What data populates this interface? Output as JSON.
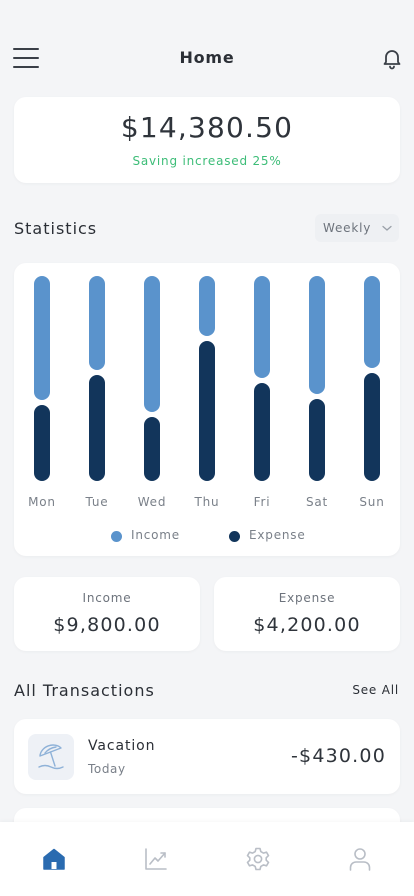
{
  "header": {
    "title": "Home",
    "menu_icon": "hamburger-menu-icon",
    "notification_icon": "bell-icon"
  },
  "balance": {
    "amount": "$14,380.50",
    "saving_text": "Saving increased 25%",
    "saving_color": "#3dbd78"
  },
  "statistics": {
    "title": "Statistics",
    "period": "Weekly",
    "legend": {
      "income": "Income",
      "expense": "Expense"
    }
  },
  "chart_data": {
    "type": "bar",
    "stacked": true,
    "categories": [
      "Mon",
      "Tue",
      "Wed",
      "Thu",
      "Fri",
      "Sat",
      "Sun"
    ],
    "series": [
      {
        "name": "Income",
        "color": "#5a93cc",
        "values": [
          62,
          47,
          68,
          30,
          51,
          59,
          46
        ]
      },
      {
        "name": "Expense",
        "color": "#12355b",
        "values": [
          38,
          53,
          32,
          70,
          49,
          41,
          54
        ]
      }
    ],
    "ylim": [
      0,
      100
    ],
    "grid": false,
    "legend_position": "bottom-center"
  },
  "summary": {
    "income_label": "Income",
    "income_value": "$9,800.00",
    "expense_label": "Expense",
    "expense_value": "$4,200.00"
  },
  "transactions": {
    "title": "All Transactions",
    "see_all": "See All",
    "items": [
      {
        "name": "Vacation",
        "date": "Today",
        "amount": "-$430.00",
        "icon": "beach-umbrella-icon"
      }
    ]
  },
  "nav": {
    "items": [
      {
        "name": "home",
        "icon": "home-icon",
        "active": true
      },
      {
        "name": "statistics",
        "icon": "chart-icon",
        "active": false
      },
      {
        "name": "settings",
        "icon": "gear-icon",
        "active": false
      },
      {
        "name": "profile",
        "icon": "user-icon",
        "active": false
      }
    ],
    "active_color": "#2a6bb0",
    "inactive_color": "#b9bec6"
  }
}
